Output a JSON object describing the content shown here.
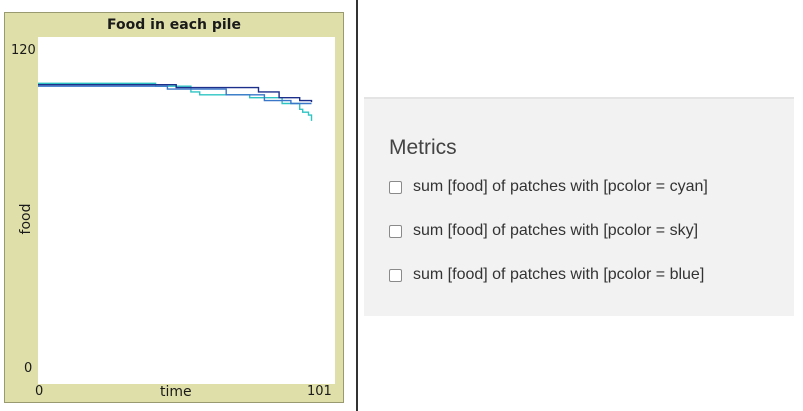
{
  "plot": {
    "title": "Food in each pile",
    "y_max_label": "120",
    "y_min_label": "0",
    "x_min_label": "0",
    "x_max_label": "101",
    "ylabel": "food",
    "xlabel": "time"
  },
  "chart_data": {
    "type": "line",
    "title": "Food in each pile",
    "xlabel": "time",
    "ylabel": "food",
    "xlim": [
      0,
      101
    ],
    "ylim": [
      0,
      120
    ],
    "series": [
      {
        "color": "#2ec4c4",
        "x": [
          0,
          39,
          40,
          50,
          52,
          55,
          68,
          72,
          80,
          83,
          87,
          89,
          90,
          92,
          93
        ],
        "y": [
          104,
          104,
          103,
          103,
          101,
          100,
          100,
          99,
          99,
          97,
          97,
          95,
          94,
          93,
          91
        ]
      },
      {
        "color": "#3a77c9",
        "x": [
          0,
          40,
          44,
          60,
          64,
          75,
          77,
          83,
          86,
          93
        ],
        "y": [
          103,
          103,
          102,
          102,
          100,
          100,
          98,
          98,
          97,
          97
        ]
      },
      {
        "color": "#1c2f8a",
        "x": [
          0,
          43,
          47,
          72,
          75,
          80,
          82,
          86,
          89,
          93
        ],
        "y": [
          103.5,
          103.5,
          102.5,
          102.5,
          101,
          101,
          99,
          99,
          98,
          97.5
        ]
      }
    ]
  },
  "metrics": {
    "title": "Metrics",
    "items": [
      {
        "label": "sum [food] of patches with [pcolor = cyan]",
        "checked": false
      },
      {
        "label": "sum [food] of patches with [pcolor = sky]",
        "checked": false
      },
      {
        "label": "sum [food] of patches with [pcolor = blue]",
        "checked": false
      }
    ]
  }
}
